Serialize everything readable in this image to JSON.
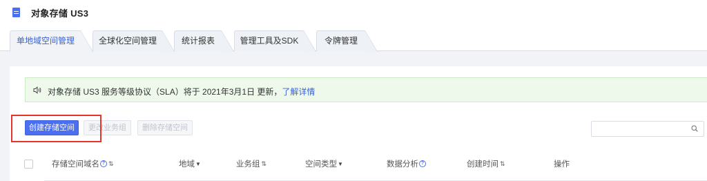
{
  "app": {
    "title": "对象存储 US3",
    "icon": "document-icon"
  },
  "tabs": [
    {
      "label": "单地域空间管理",
      "active": true
    },
    {
      "label": "全球化空间管理",
      "active": false
    },
    {
      "label": "统计报表",
      "active": false
    },
    {
      "label": "管理工具及SDK",
      "active": false
    },
    {
      "label": "令牌管理",
      "active": false
    }
  ],
  "notice": {
    "icon": "speaker-icon",
    "text": "对象存储 US3 服务等级协议（SLA）将于 2021年3月1日 更新，",
    "link": "了解详情"
  },
  "toolbar": {
    "create_label": "创建存储空间",
    "change_group_label": "更改业务组",
    "delete_label": "删除存储空间"
  },
  "search": {
    "placeholder": "",
    "value": ""
  },
  "table": {
    "columns": [
      {
        "label": "存储空间域名",
        "help": "?",
        "sort": "⇅"
      },
      {
        "label": "地域",
        "filter": "▼"
      },
      {
        "label": "业务组",
        "sort": "⇅"
      },
      {
        "label": "空间类型",
        "filter": "▼"
      },
      {
        "label": "数据分析",
        "help": "?"
      },
      {
        "label": "创建时间",
        "sort": "⇅"
      },
      {
        "label": "操作"
      }
    ]
  },
  "colors": {
    "accent": "#4a6ff0",
    "highlight": "#e8322c",
    "notice_bg": "#eef9ec"
  }
}
